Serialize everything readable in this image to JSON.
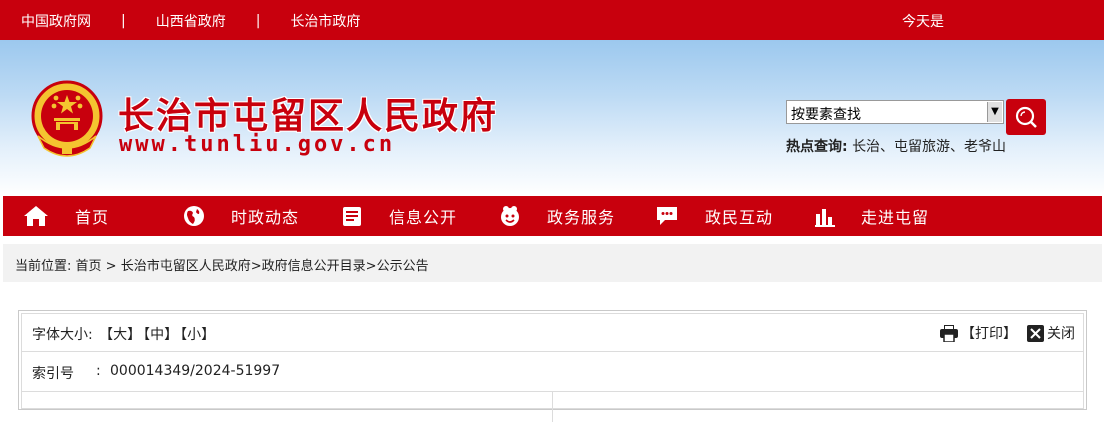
{
  "topbar": {
    "links": [
      "中国政府网",
      "山西省政府",
      "长治市政府"
    ],
    "separator": "|",
    "today": "今天是"
  },
  "header": {
    "site_title": "长治市屯留区人民政府",
    "site_domain": "www.tunliu.gov.cn",
    "search": {
      "selected": "按要素查找"
    },
    "hot": {
      "label": "热点查询:",
      "items": "长治、屯留旅游、老爷山"
    }
  },
  "nav": {
    "items": [
      {
        "label": "首页",
        "icon": "home-icon"
      },
      {
        "label": "时政动态",
        "icon": "globe-icon"
      },
      {
        "label": "信息公开",
        "icon": "document-icon"
      },
      {
        "label": "政务服务",
        "icon": "service-icon"
      },
      {
        "label": "政民互动",
        "icon": "chat-icon"
      },
      {
        "label": "走进屯留",
        "icon": "chart-icon"
      }
    ]
  },
  "breadcrumb": {
    "prefix": "当前位置:",
    "items": [
      "首页",
      "长治市屯留区人民政府",
      "政府信息公开目录",
      "公示公告"
    ],
    "first_sep": " > ",
    "sep": ">"
  },
  "article": {
    "font_size_label": "字体大小:",
    "font_sizes": [
      "【大】",
      "【中】",
      "【小】"
    ],
    "print_label": "【打印】",
    "close_label": "关闭",
    "index_key": "索引号",
    "colon": ":",
    "index_value": "000014349/2024-51997"
  },
  "colors": {
    "brand_red": "#c8000d",
    "banner_blue": "#9cc8ee"
  }
}
